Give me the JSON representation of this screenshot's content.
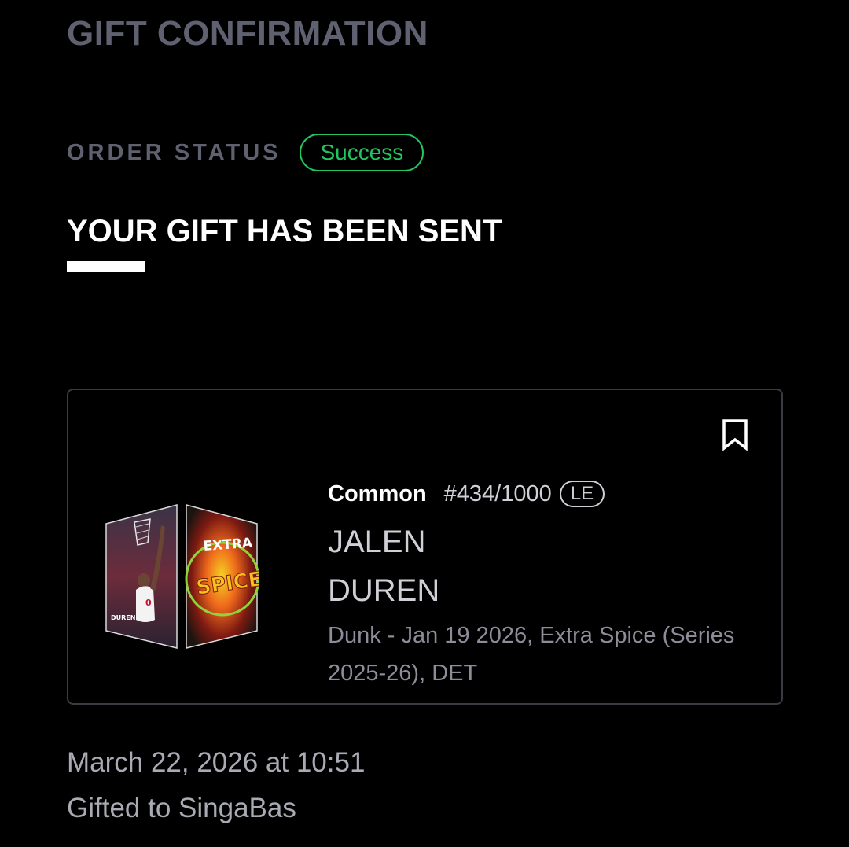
{
  "page": {
    "title": "GIFT CONFIRMATION"
  },
  "order_status": {
    "label": "ORDER STATUS",
    "value": "Success",
    "status_color": "#22c55e"
  },
  "headline": "YOUR GIFT HAS BEEN SENT",
  "moment": {
    "tier": "Common",
    "serial": "#434/1000",
    "edition_badge": "LE",
    "first_name": "JALEN",
    "last_name": "DUREN",
    "description": "Dunk - Jan 19 2026, Extra Spice (Series 2025-26), DET",
    "bookmark_icon": "bookmark-icon",
    "image": {
      "player_label": "DUREN",
      "set_word_1": "EXTRA",
      "set_word_2": "SPICE"
    }
  },
  "footer": {
    "date": "March 22, 2026 at 10:51",
    "recipient": "Gifted to SingaBas"
  }
}
